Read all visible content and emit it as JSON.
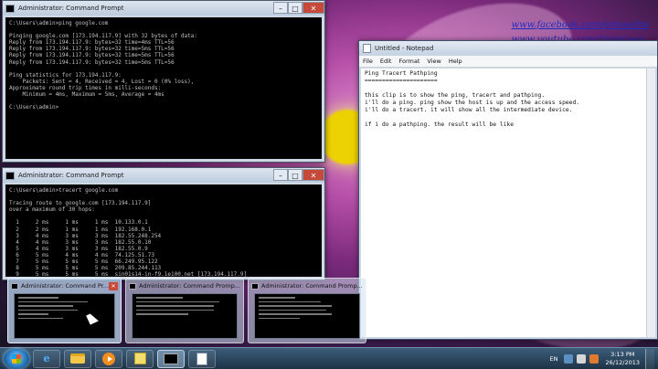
{
  "watermark": {
    "facebook": "www.facebook.com/jetweelim",
    "youtube": "www.youtube.com/limjetwee"
  },
  "cmd_ping": {
    "title": "Administrator: Command Prompt",
    "lines": [
      "C:\\Users\\admin>ping google.com",
      "",
      "Pinging google.com [173.194.117.9] with 32 bytes of data:",
      "Reply from 173.194.117.9: bytes=32 time=4ms TTL=56",
      "Reply from 173.194.117.9: bytes=32 time=5ms TTL=56",
      "Reply from 173.194.117.9: bytes=32 time=5ms TTL=56",
      "Reply from 173.194.117.9: bytes=32 time=5ms TTL=56",
      "",
      "Ping statistics for 173.194.117.9:",
      "    Packets: Sent = 4, Received = 4, Lost = 0 (0% loss),",
      "Approximate round trip times in milli-seconds:",
      "    Minimum = 4ms, Maximum = 5ms, Average = 4ms",
      "",
      "C:\\Users\\admin>"
    ]
  },
  "cmd_tracert": {
    "title": "Administrator: Command Prompt",
    "lines": [
      "C:\\Users\\admin>tracert google.com",
      "",
      "Tracing route to google.com [173.194.117.9]",
      "over a maximum of 30 hops:",
      "",
      "  1     2 ms     1 ms     1 ms  10.133.0.1",
      "  2     2 ms     1 ms     1 ms  192.168.0.1",
      "  3     4 ms     3 ms     3 ms  182.55.248.254",
      "  4     4 ms     3 ms     3 ms  182.55.0.10",
      "  5     4 ms     3 ms     3 ms  182.55.0.9",
      "  6     5 ms     4 ms     4 ms  74.125.51.73",
      "  7     5 ms     5 ms     5 ms  66.249.95.122",
      "  8     5 ms     5 ms     5 ms  209.85.244.113",
      "  9     5 ms     5 ms     5 ms  sin01s14-in-f9.1e100.net [173.194.117.9]"
    ]
  },
  "notepad": {
    "title": "Untitled - Notepad",
    "menu": [
      "File",
      "Edit",
      "Format",
      "View",
      "Help"
    ],
    "lines": [
      "Ping Tracert Pathping",
      "=====================",
      "",
      "this clip is to show the ping, tracert and pathping.",
      "i'll do a ping. ping show the host is up and the access speed.",
      "i'll do a tracert. it will show all the intermediate device.",
      "",
      "if i do a pathping. the result will be like"
    ]
  },
  "thumbnails": [
    {
      "title": "Administrator: Command Pr..."
    },
    {
      "title": "Administrator: Command Promp..."
    },
    {
      "title": "Administrator: Command Promp..."
    }
  ],
  "taskbar": {
    "lang": "EN",
    "time": "3:13 PM",
    "date": "26/12/2013"
  },
  "icons": {
    "close": "✕",
    "minimize": "–",
    "maximize": "□"
  }
}
